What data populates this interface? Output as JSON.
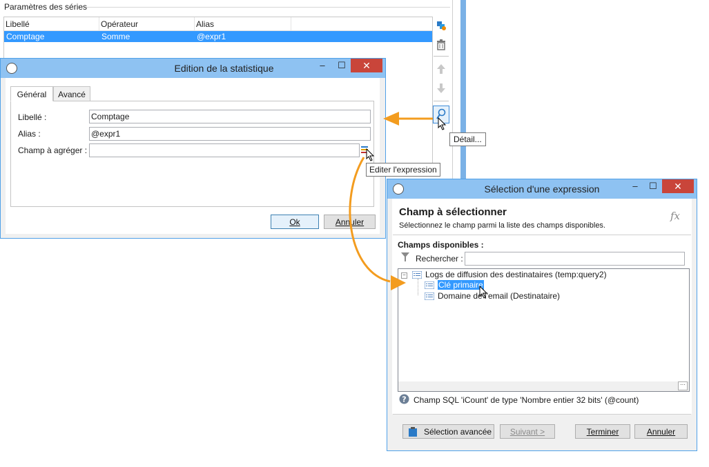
{
  "series_panel": {
    "group_label": "Paramètres des séries",
    "columns": [
      "Libellé",
      "Opérateur",
      "Alias"
    ],
    "rows": [
      {
        "libelle": "Comptage",
        "operateur": "Somme",
        "alias": "@expr1"
      }
    ],
    "tooltip": "Détail..."
  },
  "edit_dialog": {
    "title": "Edition de la statistique",
    "tabs": [
      "Général",
      "Avancé"
    ],
    "libelle_label": "Libellé :",
    "libelle_value": "Comptage",
    "alias_label": "Alias :",
    "alias_value": "@expr1",
    "champ_label": "Champ à agréger :",
    "champ_value": "",
    "tooltip": "Editer l'expression",
    "ok_label": "Ok",
    "cancel_label": "Annuler"
  },
  "select_dialog": {
    "title": "Sélection d'une expression",
    "heading": "Champ à sélectionner",
    "subheading": "Sélectionnez le champ parmi la liste des champs disponibles.",
    "fx_label": "fx",
    "available_label": "Champs disponibles :",
    "search_label": "Rechercher :",
    "search_value": "",
    "tree": {
      "root": "Logs de diffusion des destinataires (temp:query2)",
      "children": [
        "Clé primaire",
        "Domaine de l'email (Destinataire)"
      ]
    },
    "info_text": "Champ SQL 'iCount' de type 'Nombre entier 32 bits' (@count)",
    "advanced_label": "Sélection avancée",
    "next_label": "Suivant >",
    "finish_label": "Terminer",
    "cancel_label": "Annuler"
  },
  "colors": {
    "accent_orange": "#f39c1f",
    "selection_blue": "#3399ff",
    "titlebar_blue": "#8ec2f2",
    "close_red": "#c9453a"
  }
}
